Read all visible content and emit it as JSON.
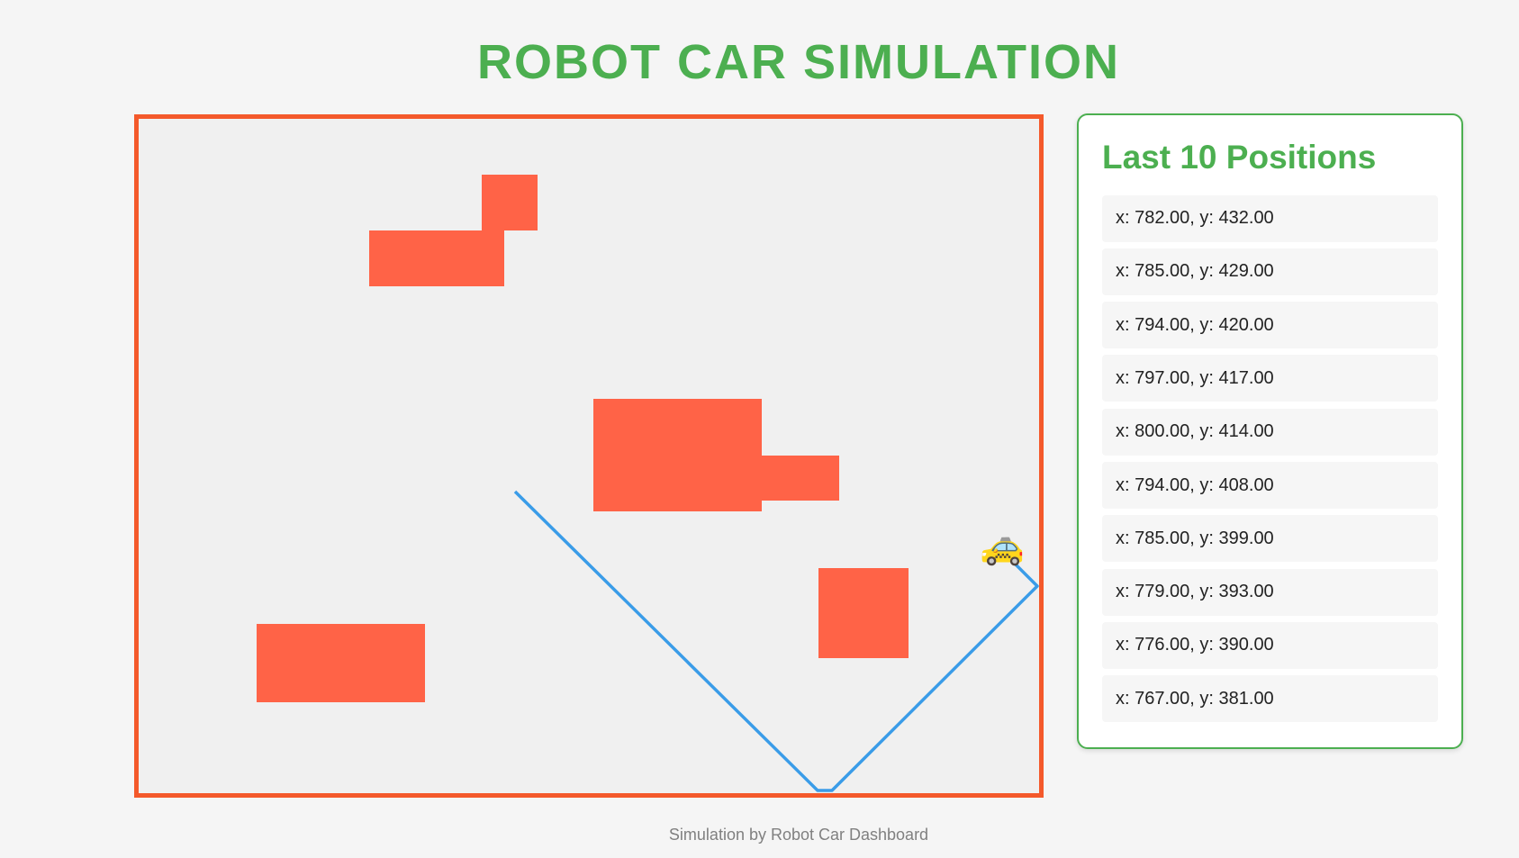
{
  "page": {
    "title": "ROBOT CAR SIMULATION",
    "footer": "Simulation by Robot Car Dashboard"
  },
  "colors": {
    "title": "#4caf50",
    "canvas_border": "#f4592b",
    "canvas_background": "#f0f0f0",
    "obstacle": "#ff6347",
    "path": "#3a9ce8",
    "panel_border": "#4caf50"
  },
  "simulation": {
    "car_icon": "🚕",
    "car_icon_name": "car-icon"
  },
  "positions_panel": {
    "heading": "Last 10 Positions",
    "items": [
      "x: 782.00, y: 432.00",
      "x: 785.00, y: 429.00",
      "x: 794.00, y: 420.00",
      "x: 797.00, y: 417.00",
      "x: 800.00, y: 414.00",
      "x: 794.00, y: 408.00",
      "x: 785.00, y: 399.00",
      "x: 779.00, y: 393.00",
      "x: 776.00, y: 390.00",
      "x: 767.00, y: 381.00"
    ]
  }
}
